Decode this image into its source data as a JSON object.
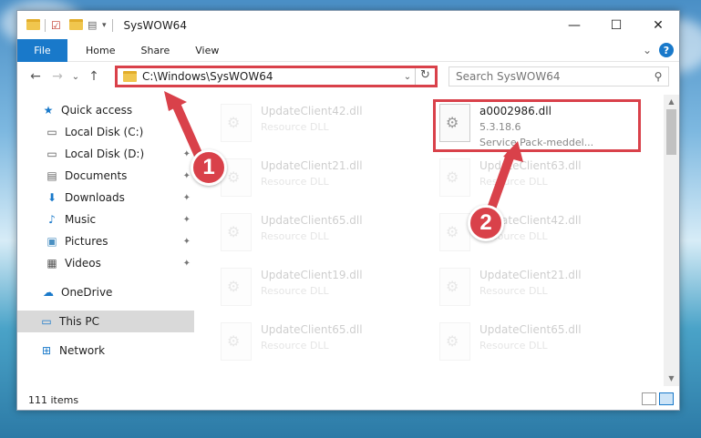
{
  "window": {
    "title": "SysWOW64",
    "minimize_glyph": "—",
    "maximize_glyph": "☐",
    "close_glyph": "✕"
  },
  "ribbon": {
    "tabs": [
      "File",
      "Home",
      "Share",
      "View"
    ],
    "expand_glyph": "⌄",
    "help_glyph": "?"
  },
  "navigation": {
    "back_glyph": "←",
    "forward_glyph": "→",
    "recent_glyph": "⌄",
    "up_glyph": "↑",
    "address_path": "C:\\Windows\\SysWOW64",
    "address_dropdown_glyph": "⌄",
    "refresh_glyph": "↻",
    "search_placeholder": "Search SysWOW64",
    "search_glyph": "⚲"
  },
  "sidebar": {
    "items": [
      {
        "label": "Quick access",
        "icon": "star-icon",
        "glyph": "★",
        "pinned": false
      },
      {
        "label": "Local Disk (C:)",
        "icon": "drive-icon",
        "glyph": "▭",
        "pinned": true
      },
      {
        "label": "Local Disk (D:)",
        "icon": "drive-icon",
        "glyph": "▭",
        "pinned": true
      },
      {
        "label": "Documents",
        "icon": "documents-icon",
        "glyph": "▤",
        "pinned": true
      },
      {
        "label": "Downloads",
        "icon": "downloads-icon",
        "glyph": "⬇",
        "pinned": true
      },
      {
        "label": "Music",
        "icon": "music-icon",
        "glyph": "♪",
        "pinned": true
      },
      {
        "label": "Pictures",
        "icon": "pictures-icon",
        "glyph": "▣",
        "pinned": true
      },
      {
        "label": "Videos",
        "icon": "videos-icon",
        "glyph": "▦",
        "pinned": true
      },
      {
        "label": "OneDrive",
        "icon": "cloud-icon",
        "glyph": "☁",
        "pinned": false
      },
      {
        "label": "This PC",
        "icon": "computer-icon",
        "glyph": "▭",
        "pinned": false,
        "selected": true
      },
      {
        "label": "Network",
        "icon": "network-icon",
        "glyph": "⊞",
        "pinned": false
      }
    ],
    "pin_glyph": "📌"
  },
  "files": [
    {
      "name": "UpdateClient42.dll",
      "sub": "Resource DLL",
      "faded": true
    },
    {
      "name": "a0002986.dll",
      "sub": "5.3.18.6",
      "sub2": "Service Pack-meddel...",
      "faded": false,
      "highlighted": true
    },
    {
      "name": "UpdateClient21.dll",
      "sub": "Resource DLL",
      "faded": true
    },
    {
      "name": "UpdateClient63.dll",
      "sub": "Resource DLL",
      "faded": true
    },
    {
      "name": "UpdateClient65.dll",
      "sub": "Resource DLL",
      "faded": true
    },
    {
      "name": "UpdateClient42.dll",
      "sub": "Resource DLL",
      "faded": true
    },
    {
      "name": "UpdateClient19.dll",
      "sub": "Resource DLL",
      "faded": true
    },
    {
      "name": "UpdateClient21.dll",
      "sub": "Resource DLL",
      "faded": true
    },
    {
      "name": "UpdateClient65.dll",
      "sub": "Resource DLL",
      "faded": true
    },
    {
      "name": "UpdateClient65.dll",
      "sub": "Resource DLL",
      "faded": true
    }
  ],
  "status": {
    "item_count": "111 items"
  },
  "scrollbar": {
    "up_glyph": "▲",
    "down_glyph": "▼"
  },
  "annotations": {
    "step1": "1",
    "step2": "2",
    "color": "#d9414a"
  }
}
